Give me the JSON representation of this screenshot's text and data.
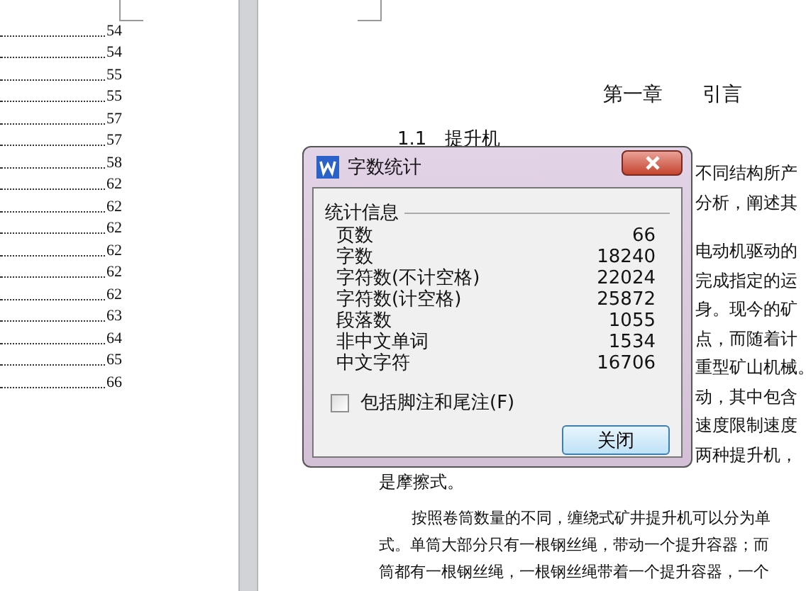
{
  "toc": {
    "page_numbers": [
      "54",
      "54",
      "55",
      "55",
      "57",
      "57",
      "58",
      "62",
      "62",
      "62",
      "62",
      "62",
      "62",
      "63",
      "64",
      "65",
      "66"
    ]
  },
  "document": {
    "chapter_title": "第一章　　引言",
    "section_title": "1.1　提升机",
    "side_paragraphs": [
      [
        "不同结构所产",
        "分析，阐述其"
      ],
      [
        "电动机驱动的",
        "完成指定的运",
        "身。现今的矿",
        "点，而随着计",
        "重型矿山机械。",
        "动，其中包含",
        "速度限制速度",
        "两种提升机，"
      ]
    ],
    "closing_fragment": "是摩擦式。",
    "paragraph_lines": [
      "按照卷筒数量的不同，缠绕式矿井提升机可以分为单",
      "式。单筒大部分只有一根钢丝绳，带动一个提升容器；而",
      "筒都有一根钢丝绳，一根钢丝绳带着一个提升容器，一个"
    ]
  },
  "dialog": {
    "title": "字数统计",
    "group_label": "统计信息",
    "stats": [
      {
        "label": "页数",
        "value": "66"
      },
      {
        "label": "字数",
        "value": "18240"
      },
      {
        "label": "字符数(不计空格)",
        "value": "22024"
      },
      {
        "label": "字符数(计空格)",
        "value": "25872"
      },
      {
        "label": "段落数",
        "value": "1055"
      },
      {
        "label": "非中文单词",
        "value": "1534"
      },
      {
        "label": "中文字符",
        "value": "16706"
      }
    ],
    "checkbox": {
      "label": "包括脚注和尾注(F)",
      "checked": false
    },
    "buttons": [
      "关闭"
    ]
  }
}
